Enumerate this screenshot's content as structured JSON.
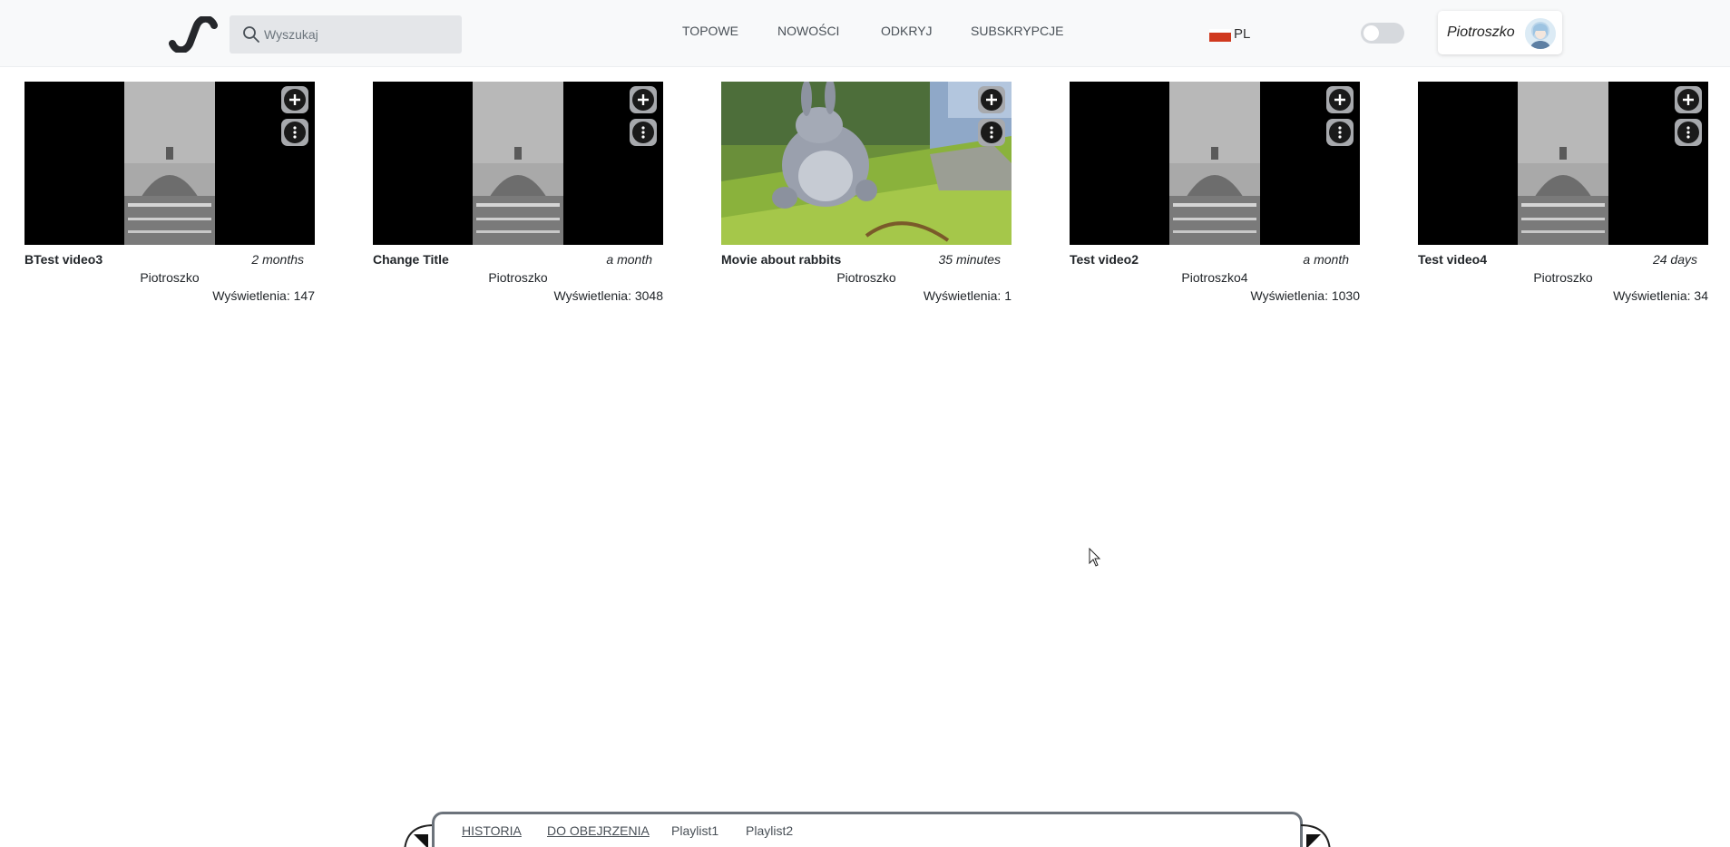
{
  "header": {
    "search_placeholder": "Wyszukaj",
    "nav": [
      "TOPOWE",
      "NOWOŚCI",
      "ODKRYJ",
      "SUBSKRYPCJE"
    ],
    "language": "PL",
    "theme_toggle_on": false,
    "user_name": "Piotroszko"
  },
  "videos": [
    {
      "title": "BTest video3",
      "date": "2 months",
      "author": "Piotroszko",
      "views": "Wyświetlenia: 147",
      "thumbnail": "dome-building"
    },
    {
      "title": "Change Title",
      "date": "a month",
      "author": "Piotroszko",
      "views": "Wyświetlenia: 3048",
      "thumbnail": "dome-building"
    },
    {
      "title": "Movie about rabbits",
      "date": "35 minutes",
      "author": "Piotroszko",
      "views": "Wyświetlenia: 1",
      "thumbnail": "big-rabbit"
    },
    {
      "title": "Test video2",
      "date": "a month",
      "author": "Piotroszko4",
      "views": "Wyświetlenia: 1030",
      "thumbnail": "dome-building"
    },
    {
      "title": "Test video4",
      "date": "24 days",
      "author": "Piotroszko",
      "views": "Wyświetlenia: 34",
      "thumbnail": "dome-building"
    }
  ],
  "bottom_tabs": [
    "HISTORIA",
    "DO OBEJRZENIA",
    "Playlist1",
    "Playlist2"
  ],
  "colors": {
    "header_bg": "#f8f9fa",
    "search_bg": "#e4e6e9",
    "flag_red": "#d0391e",
    "panel_border": "#6c737b"
  }
}
